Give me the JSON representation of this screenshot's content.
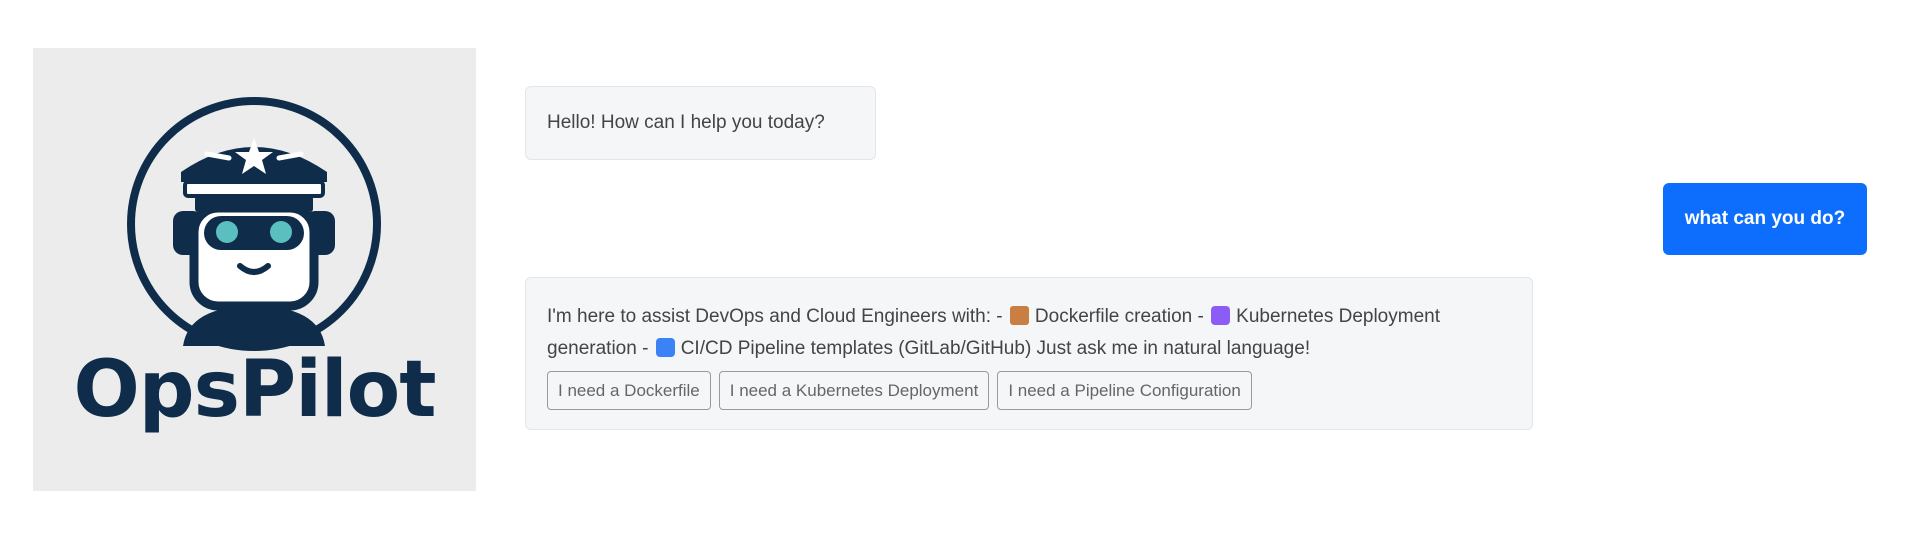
{
  "logo": {
    "name": "OpsPilot",
    "icon": "robot-pilot-icon"
  },
  "messages": {
    "greeting": "Hello! How can I help you today?",
    "user": "what can you do?",
    "reply_parts": {
      "p1": "I'm here to assist DevOps and Cloud Engineers with: -",
      "p2": "Dockerfile creation -",
      "p3": "Kubernetes Deployment generation -",
      "p4": "CI/CD Pipeline templates (GitLab/GitHub) Just ask me in natural language!"
    },
    "reply_icons": [
      "package-icon",
      "kubernetes-icon",
      "cycle-arrows-icon"
    ]
  },
  "quick_replies": [
    "I need a Dockerfile",
    "I need a Kubernetes Deployment",
    "I need a Pipeline Configuration"
  ],
  "colors": {
    "brand": "#0f2d4a",
    "accent": "#0d6efd",
    "eye": "#5bbfbf"
  }
}
